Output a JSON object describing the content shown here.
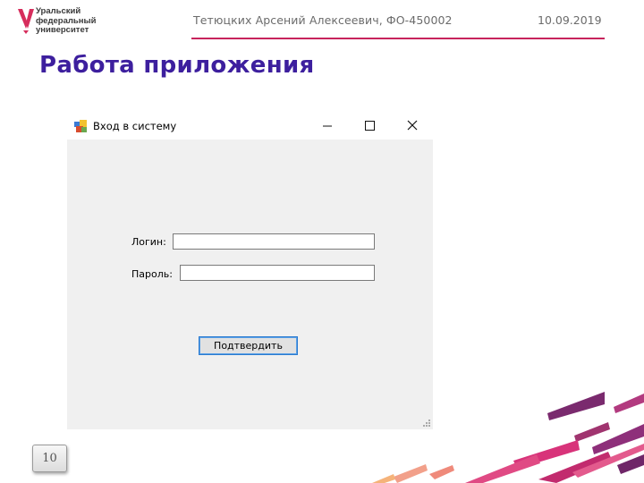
{
  "header": {
    "logo_lines": [
      "Уральский",
      "федеральный",
      "университет"
    ],
    "author": "Тетюцких Арсений Алексеевич, ФО-450002",
    "date": "10.09.2019",
    "title": "Работа приложения"
  },
  "window": {
    "title": "Вход в систему",
    "icons": [
      "app-icon",
      "minimize-icon",
      "maximize-icon",
      "close-icon"
    ],
    "login_label": "Логин:",
    "login_value": "",
    "password_label": "Пароль:",
    "password_value": "",
    "confirm_label": "Подтвердить"
  },
  "slide": {
    "number": "10"
  },
  "colors": {
    "accent": "#c7245c",
    "title": "#3d1f9e",
    "window_bg": "#f0f0f0",
    "button_border": "#2b7bd0"
  }
}
